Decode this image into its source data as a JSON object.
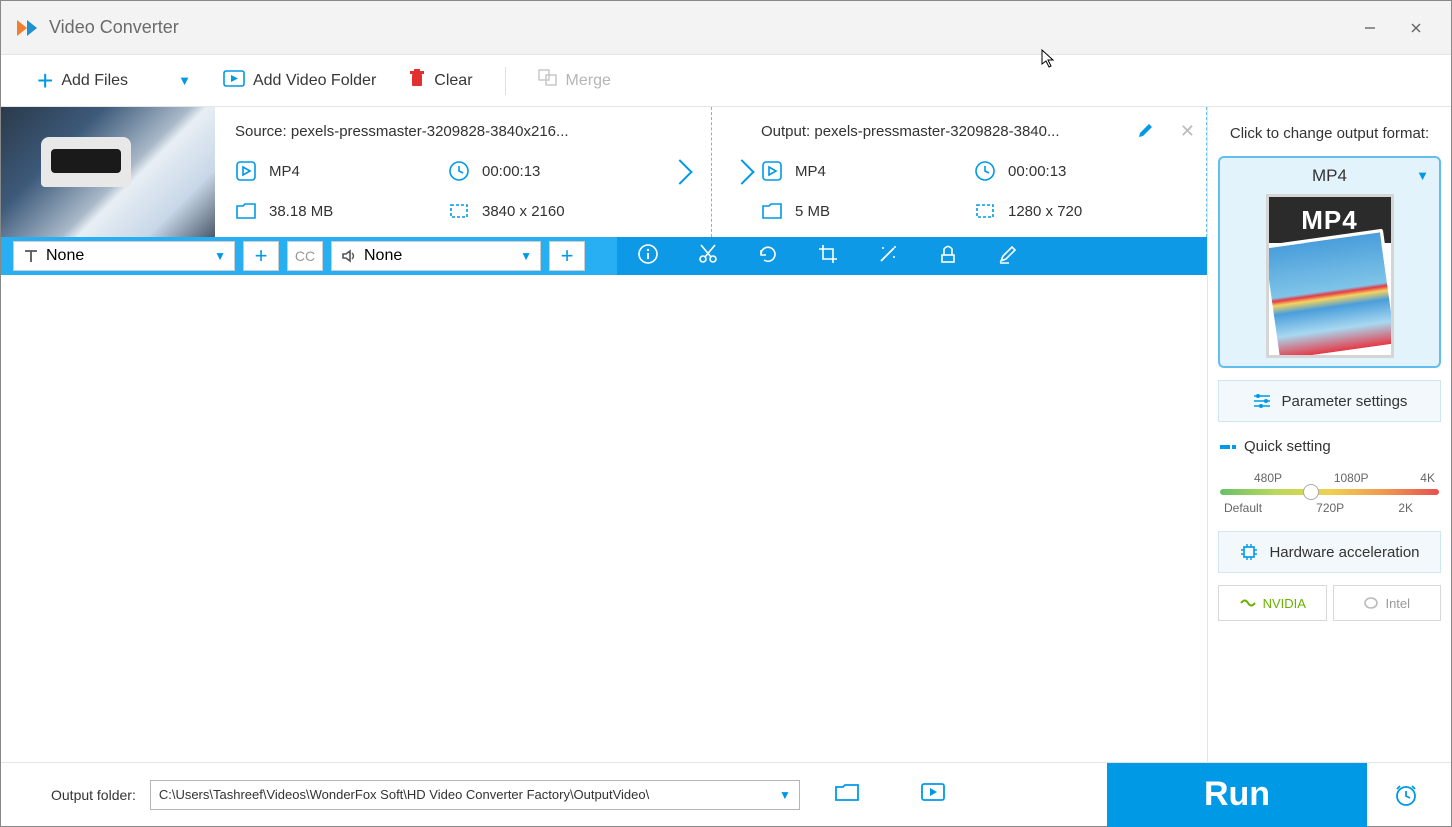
{
  "app": {
    "title": "Video Converter"
  },
  "toolbar": {
    "add_files": "Add Files",
    "add_folder": "Add Video Folder",
    "clear": "Clear",
    "merge": "Merge"
  },
  "file": {
    "source": {
      "label": "Source: pexels-pressmaster-3209828-3840x216...",
      "format": "MP4",
      "duration": "00:00:13",
      "size": "38.18 MB",
      "resolution": "3840 x 2160"
    },
    "output": {
      "label": "Output: pexels-pressmaster-3209828-3840...",
      "format": "MP4",
      "duration": "00:00:13",
      "size": "5 MB",
      "resolution": "1280 x 720"
    },
    "subtitle": "None",
    "audio": "None"
  },
  "right": {
    "title": "Click to change output format:",
    "format_label": "MP4",
    "format_badge": "MP4",
    "params_btn": "Parameter settings",
    "quick_label": "Quick setting",
    "slider": {
      "top": [
        "480P",
        "1080P",
        "4K"
      ],
      "bottom": [
        "Default",
        "720P",
        "2K"
      ]
    },
    "hw_accel": "Hardware acceleration",
    "nvidia": "NVIDIA",
    "intel": "Intel"
  },
  "footer": {
    "label": "Output folder:",
    "path": "C:\\Users\\Tashreef\\Videos\\WonderFox Soft\\HD Video Converter Factory\\OutputVideo\\",
    "run": "Run"
  }
}
